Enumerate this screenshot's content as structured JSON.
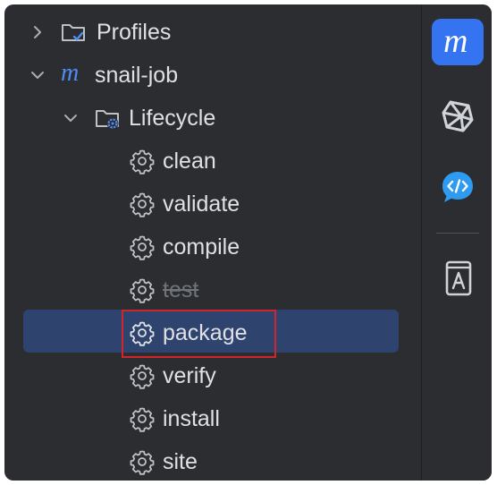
{
  "tree": {
    "profiles": {
      "label": "Profiles",
      "icon": "folder-check-icon",
      "chevron": "chevron-right-icon"
    },
    "project": {
      "label": "snail-job",
      "icon": "maven-m-icon",
      "chevron": "chevron-down-icon"
    },
    "lifecycle": {
      "label": "Lifecycle",
      "icon": "folder-gear-icon",
      "chevron": "chevron-down-icon"
    },
    "phases": [
      {
        "label": "clean",
        "icon": "gear-icon",
        "disabled": false,
        "selected": false
      },
      {
        "label": "validate",
        "icon": "gear-icon",
        "disabled": false,
        "selected": false
      },
      {
        "label": "compile",
        "icon": "gear-icon",
        "disabled": false,
        "selected": false
      },
      {
        "label": "test",
        "icon": "gear-icon",
        "disabled": true,
        "selected": false
      },
      {
        "label": "package",
        "icon": "gear-icon",
        "disabled": false,
        "selected": true
      },
      {
        "label": "verify",
        "icon": "gear-icon",
        "disabled": false,
        "selected": false
      },
      {
        "label": "install",
        "icon": "gear-icon",
        "disabled": false,
        "selected": false
      },
      {
        "label": "site",
        "icon": "gear-icon",
        "disabled": false,
        "selected": false
      }
    ]
  },
  "toolbar": {
    "items": [
      {
        "name": "maven-tool-button",
        "icon": "maven-m-icon",
        "active": true
      },
      {
        "name": "ai-tool-button",
        "icon": "ai-spark-icon",
        "active": false
      },
      {
        "name": "code-chat-button",
        "icon": "code-chat-icon",
        "active": false
      },
      {
        "name": "dictionary-button",
        "icon": "book-icon",
        "active": false
      }
    ]
  },
  "colors": {
    "background": "#2b2d30",
    "text": "#dfe1e5",
    "selection": "#2e436e",
    "accent": "#3574f0",
    "highlight_border": "#d0262b",
    "disabled_text": "#6f737a"
  }
}
